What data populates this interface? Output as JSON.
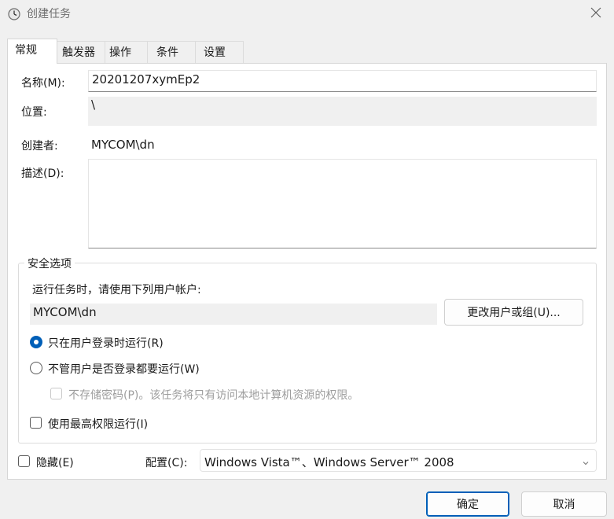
{
  "window": {
    "title": "创建任务",
    "icon": "clock-icon",
    "close_icon": "close-icon"
  },
  "tabs": [
    {
      "label": "常规",
      "active": true
    },
    {
      "label": "触发器",
      "active": false
    },
    {
      "label": "操作",
      "active": false
    },
    {
      "label": "条件",
      "active": false
    },
    {
      "label": "设置",
      "active": false
    }
  ],
  "general": {
    "name_label": "名称(M):",
    "name_value": "20201207xymEp2",
    "location_label": "位置:",
    "location_value": "\\",
    "author_label": "创建者:",
    "author_value": "MYCOM\\dn",
    "description_label": "描述(D):",
    "description_value": ""
  },
  "security": {
    "group_title": "安全选项",
    "run_as_prompt": "运行任务时，请使用下列用户帐户:",
    "user_account": "MYCOM\\dn",
    "change_user_button": "更改用户或组(U)...",
    "run_only_logged_on": "只在用户登录时运行(R)",
    "run_whether_logged_on": "不管用户是否登录都要运行(W)",
    "do_not_store_password": "不存储密码(P)。该任务将只有访问本地计算机资源的权限。",
    "run_highest_privileges": "使用最高权限运行(I)",
    "selected_option": "run_only_logged_on"
  },
  "footer": {
    "hidden_label": "隐藏(E)",
    "configure_label": "配置(C):",
    "configure_value": "Windows Vista™、Windows Server™ 2008",
    "ok_button": "确定",
    "cancel_button": "取消"
  },
  "colors": {
    "accent": "#005fb8",
    "window_bg": "#f0f0f0",
    "panel_bg": "#ffffff"
  }
}
